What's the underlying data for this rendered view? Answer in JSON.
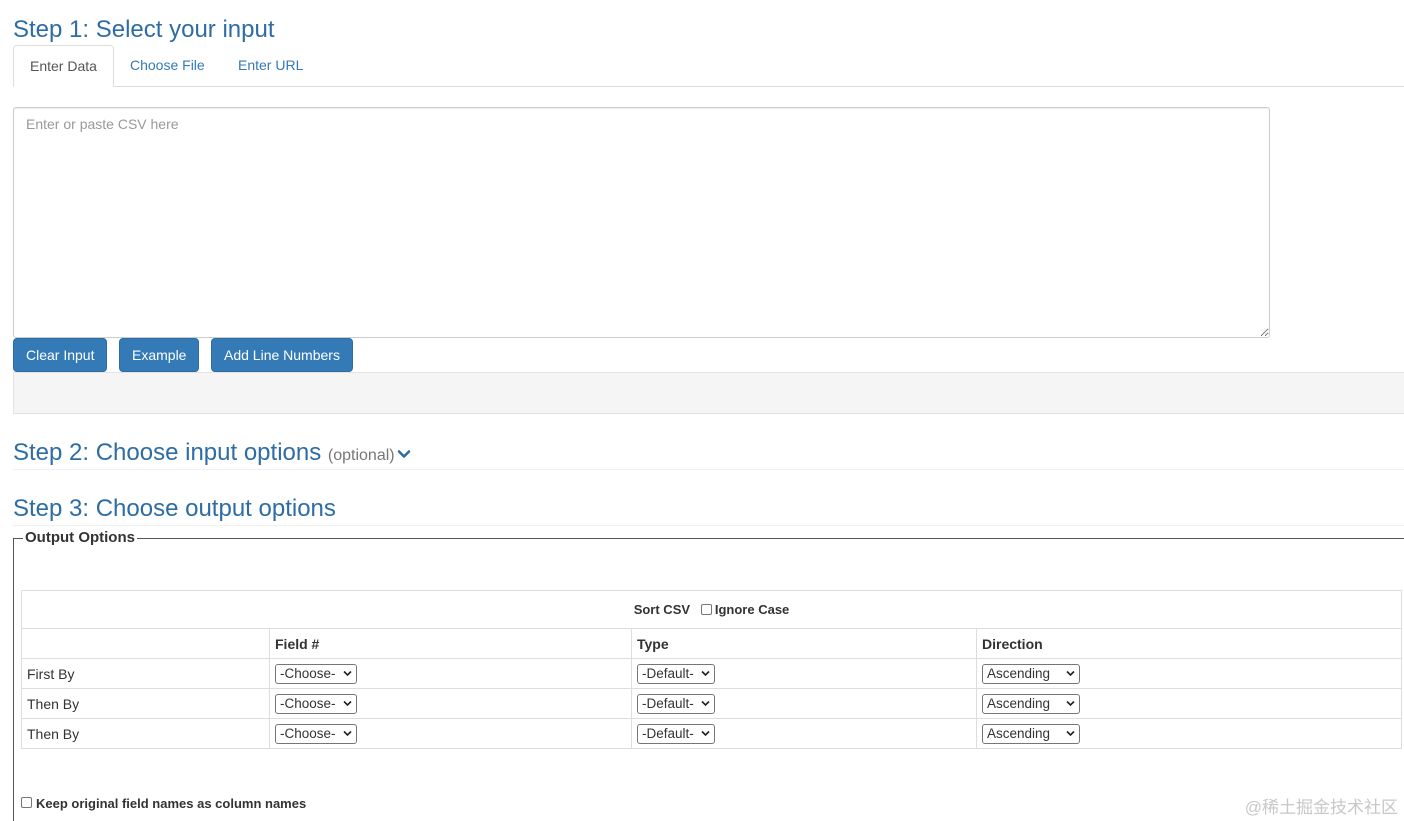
{
  "step1": {
    "title": "Step 1: Select your input",
    "tabs": [
      {
        "label": "Enter Data",
        "active": true
      },
      {
        "label": "Choose File",
        "active": false
      },
      {
        "label": "Enter URL",
        "active": false
      }
    ],
    "textarea": {
      "value": "",
      "placeholder": "Enter or paste CSV here"
    },
    "buttons": {
      "clear": "Clear Input",
      "example": "Example",
      "line_numbers": "Add Line Numbers"
    }
  },
  "step2": {
    "title": "Step 2: Choose input options",
    "optional": "(optional)",
    "icon": "chevron-down-icon"
  },
  "step3": {
    "title": "Step 3: Choose output options",
    "legend": "Output Options",
    "sort": {
      "caption": "Sort CSV",
      "ignore_case": "Ignore Case",
      "headers": {
        "field": "Field #",
        "type": "Type",
        "direction": "Direction"
      },
      "rows": [
        {
          "label": "First By",
          "field": "-Choose-",
          "type": "-Default-",
          "direction": "Ascending"
        },
        {
          "label": "Then By",
          "field": "-Choose-",
          "type": "-Default-",
          "direction": "Ascending"
        },
        {
          "label": "Then By",
          "field": "-Choose-",
          "type": "-Default-",
          "direction": "Ascending"
        }
      ]
    },
    "keep_field_names": "Keep original field names as column names"
  },
  "watermark": "@稀土掘金技术社区",
  "colors": {
    "primary": "#337ab7",
    "heading": "#2e6da4",
    "well": "#f5f5f5"
  }
}
